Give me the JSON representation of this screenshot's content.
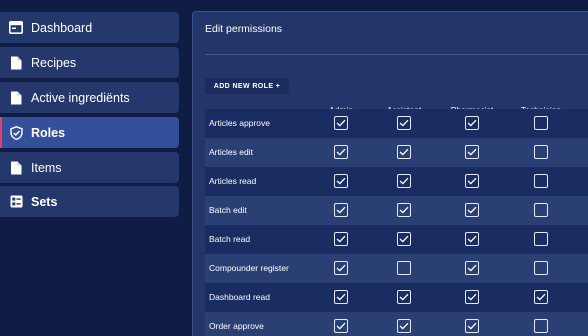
{
  "sidebar": {
    "items": [
      {
        "label": "Dashboard",
        "icon": "dashboard-icon",
        "active": false,
        "bold": false
      },
      {
        "label": "Recipes",
        "icon": "document-icon",
        "active": false,
        "bold": false
      },
      {
        "label": "Active ingrediënts",
        "icon": "document-icon",
        "active": false,
        "bold": false
      },
      {
        "label": "Roles",
        "icon": "shield-check-icon",
        "active": true,
        "bold": true
      },
      {
        "label": "Items",
        "icon": "document-icon",
        "active": false,
        "bold": false
      },
      {
        "label": "Sets",
        "icon": "list-icon",
        "active": false,
        "bold": true
      }
    ]
  },
  "panel": {
    "title": "Edit permissions",
    "add_button_label": "ADD NEW ROLE +"
  },
  "roles": [
    "Admin",
    "Assistant",
    "Pharmacist",
    "Technician"
  ],
  "permissions": [
    {
      "name": "Articles approve",
      "values": [
        true,
        true,
        true,
        false
      ]
    },
    {
      "name": "Articles edit",
      "values": [
        true,
        true,
        true,
        false
      ]
    },
    {
      "name": "Articles read",
      "values": [
        true,
        true,
        true,
        false
      ]
    },
    {
      "name": "Batch edit",
      "values": [
        true,
        true,
        true,
        false
      ]
    },
    {
      "name": "Batch read",
      "values": [
        true,
        true,
        true,
        false
      ]
    },
    {
      "name": "Compounder register",
      "values": [
        true,
        false,
        true,
        false
      ]
    },
    {
      "name": "Dashboard read",
      "values": [
        true,
        true,
        true,
        true
      ]
    },
    {
      "name": "Order approve",
      "values": [
        true,
        true,
        true,
        false
      ]
    }
  ],
  "colors": {
    "background": "#0f1d44",
    "nav_item": "#25386b",
    "nav_item_active": "#35509a",
    "active_accent": "#e0406a",
    "panel": "#22366a"
  }
}
